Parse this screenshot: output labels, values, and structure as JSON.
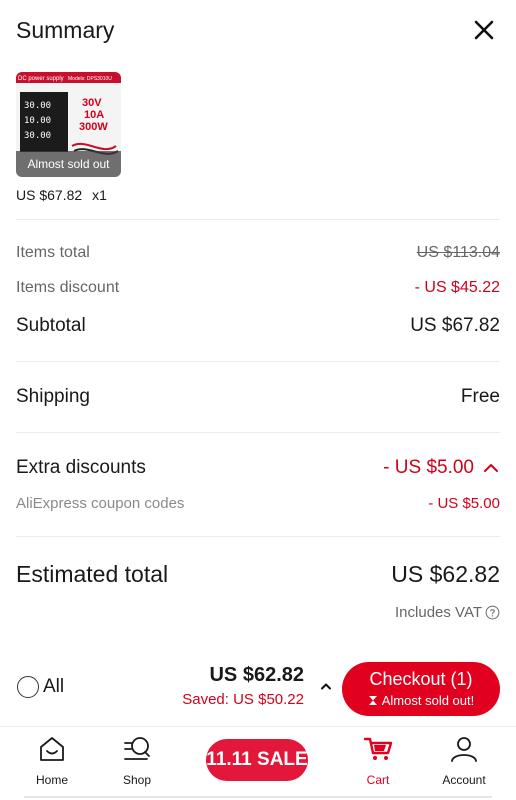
{
  "header": {
    "title": "Summary"
  },
  "product": {
    "overlay": "Almost sold out",
    "price": "US $67.82",
    "quantity": "x1",
    "image_text": {
      "top_left": "DC power supply",
      "top_right": "Models: DPS3010U",
      "spec1": "30V",
      "spec2": "10A",
      "spec3": "300W",
      "d1": "30.00",
      "d2": "10.00",
      "d3": "30.00"
    }
  },
  "summary": {
    "items_total_label": "Items total",
    "items_total_value": "US $113.04",
    "items_discount_label": "Items discount",
    "items_discount_value": "- US $45.22",
    "subtotal_label": "Subtotal",
    "subtotal_value": "US $67.82",
    "shipping_label": "Shipping",
    "shipping_value": "Free",
    "extra_discounts_label": "Extra discounts",
    "extra_discounts_value": "- US $5.00",
    "coupon_label": "AliExpress coupon codes",
    "coupon_value": "- US $5.00",
    "estimated_total_label": "Estimated total",
    "estimated_total_value": "US $62.82",
    "vat_note": "Includes VAT"
  },
  "checkout": {
    "all_label": "All",
    "total": "US $62.82",
    "saved": "Saved: US $50.22",
    "button_label": "Checkout (1)",
    "button_sub": "Almost sold out!"
  },
  "tabbar": {
    "home": "Home",
    "shop": "Shop",
    "sale": "11.11 SALE",
    "cart": "Cart",
    "account": "Account"
  },
  "colors": {
    "accent": "#e2001f",
    "discount": "#d0021b",
    "muted": "#666666"
  }
}
